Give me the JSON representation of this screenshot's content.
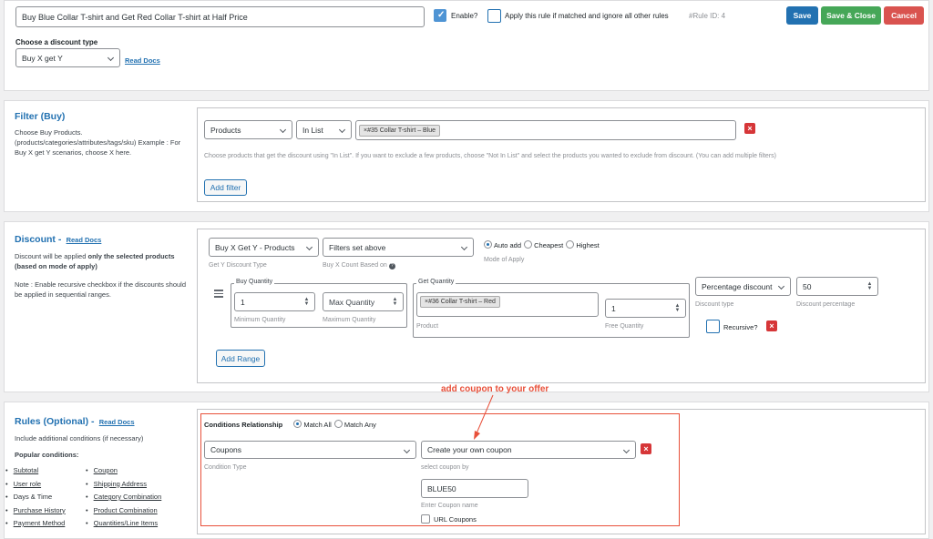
{
  "header": {
    "rule_name": "Buy Blue Collar T-shirt and Get Red Collar T-shirt at Half Price",
    "enable_label": "Enable?",
    "apply_label": "Apply this rule if matched and ignore all other rules",
    "rule_id": "#Rule ID: 4",
    "save": "Save",
    "save_close": "Save & Close",
    "cancel": "Cancel",
    "discount_type_label": "Choose a discount type",
    "discount_type_value": "Buy X get Y",
    "read_docs": "Read Docs"
  },
  "filter": {
    "title": "Filter (Buy)",
    "description": "Choose Buy Products. (products/categories/attributes/tags/sku) Example : For Buy X get Y scenarios, choose X here.",
    "type": "Products",
    "operator": "In List",
    "chip": "×#35 Collar T-shirt – Blue",
    "hint": "Choose products that get the discount using \"In List\". If you want to exclude a few products, choose \"Not In List\" and select the products you wanted to exclude from discount. (You can add multiple filters)",
    "add_filter": "Add filter"
  },
  "discount": {
    "title": "Discount -",
    "read_docs": "Read Docs",
    "desc1": "Discount will be applied",
    "desc_bold": "only the selected products (based on mode of apply)",
    "note": "Note : Enable recursive checkbox if the discounts should be applied in sequential ranges.",
    "get_y_type": "Buy X Get Y - Products",
    "get_y_type_label": "Get Y Discount Type",
    "count_based": "Filters set above",
    "count_based_label": "Buy X Count Based on",
    "mode_auto": "Auto add",
    "mode_cheapest": "Cheapest",
    "mode_highest": "Highest",
    "mode_label": "Mode of Apply",
    "buy_qty_legend": "Buy Quantity",
    "min_qty": "1",
    "min_label": "Minimum Quantity",
    "max_placeholder": "Max Quantity",
    "max_label": "Maximum Quantity",
    "get_qty_legend": "Get Quantity",
    "get_chip": "×#36 Collar T-shirt – Red",
    "product_label": "Product",
    "free_qty": "1",
    "free_label": "Free Quantity",
    "disc_type": "Percentage discount",
    "disc_type_label": "Discount type",
    "disc_pct": "50",
    "disc_pct_label": "Discount percentage",
    "recursive": "Recursive?",
    "add_range": "Add Range"
  },
  "rules": {
    "title": "Rules (Optional) -",
    "read_docs": "Read Docs",
    "desc": "Include additional conditions (if necessary)",
    "popular": "Popular conditions:",
    "col1": [
      "Subtotal",
      "User role",
      "Days & Time",
      "Purchase History",
      "Payment Method"
    ],
    "col2": [
      "Coupon",
      "Shipping Address",
      "Category Combination",
      "Product Combination",
      "Quantities/Line Items"
    ],
    "relationship": "Conditions Relationship",
    "match_all": "Match All",
    "match_any": "Match Any",
    "condition_type": "Coupons",
    "condition_type_label": "Condition Type",
    "coupon_mode": "Create your own coupon",
    "coupon_mode_label": "select coupon by",
    "coupon_name": "BLUE50",
    "coupon_name_label": "Enter Coupon name",
    "url_coupons": "URL Coupons",
    "annotation": "add coupon to your offer"
  }
}
